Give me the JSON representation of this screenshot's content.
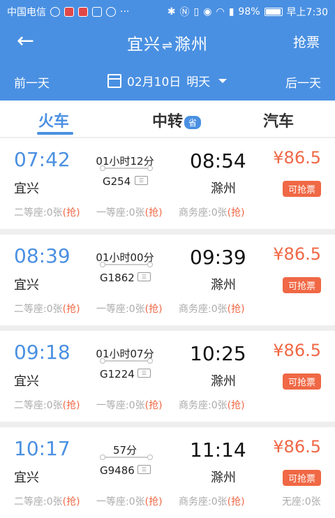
{
  "status_bar": {
    "carrier": "中国电信",
    "more": "···",
    "battery": "98%",
    "time": "早上7:30"
  },
  "header": {
    "back_icon": "arrow-left-icon",
    "title_from": "宜兴",
    "title_arrows": "⇌",
    "title_to": "滁州",
    "grab_ticket": "抢票"
  },
  "date_bar": {
    "prev_day": "前一天",
    "date": "02月10日",
    "relative": "明天",
    "next_day": "后一天"
  },
  "tabs": {
    "train": "火车",
    "transfer": "中转",
    "transfer_badge": "省",
    "bus": "汽车"
  },
  "trains": [
    {
      "dep_time": "07:42",
      "dep_station": "宜兴",
      "duration": "01小时12分",
      "train_no": "G254",
      "arr_time": "08:54",
      "arr_station": "滁州",
      "price": "¥86.5",
      "action": "可抢票",
      "seats": [
        {
          "label": "二等座:0张",
          "grab": "(抢)"
        },
        {
          "label": "一等座:0张",
          "grab": "(抢)"
        },
        {
          "label": "商务座:0张",
          "grab": "(抢)"
        }
      ]
    },
    {
      "dep_time": "08:39",
      "dep_station": "宜兴",
      "duration": "01小时00分",
      "train_no": "G1862",
      "arr_time": "09:39",
      "arr_station": "滁州",
      "price": "¥86.5",
      "action": "可抢票",
      "seats": [
        {
          "label": "二等座:0张",
          "grab": "(抢)"
        },
        {
          "label": "一等座:0张",
          "grab": "(抢)"
        },
        {
          "label": "商务座:0张",
          "grab": "(抢)"
        }
      ]
    },
    {
      "dep_time": "09:18",
      "dep_station": "宜兴",
      "duration": "01小时07分",
      "train_no": "G1224",
      "arr_time": "10:25",
      "arr_station": "滁州",
      "price": "¥86.5",
      "action": "可抢票",
      "seats": [
        {
          "label": "二等座:0张",
          "grab": "(抢)"
        },
        {
          "label": "一等座:0张",
          "grab": "(抢)"
        },
        {
          "label": "商务座:0张",
          "grab": "(抢)"
        }
      ]
    },
    {
      "dep_time": "10:17",
      "dep_station": "宜兴",
      "duration": "57分",
      "train_no": "G9486",
      "arr_time": "11:14",
      "arr_station": "滁州",
      "price": "¥86.5",
      "action": "可抢票",
      "seats": [
        {
          "label": "二等座:0张",
          "grab": "(抢)"
        },
        {
          "label": "一等座:0张",
          "grab": "(抢)"
        },
        {
          "label": "商务座:0张",
          "grab": "(抢)"
        },
        {
          "label": "无座:0张",
          "grab": ""
        }
      ]
    }
  ],
  "colors": {
    "primary": "#4a90e2",
    "accent": "#f06845"
  }
}
